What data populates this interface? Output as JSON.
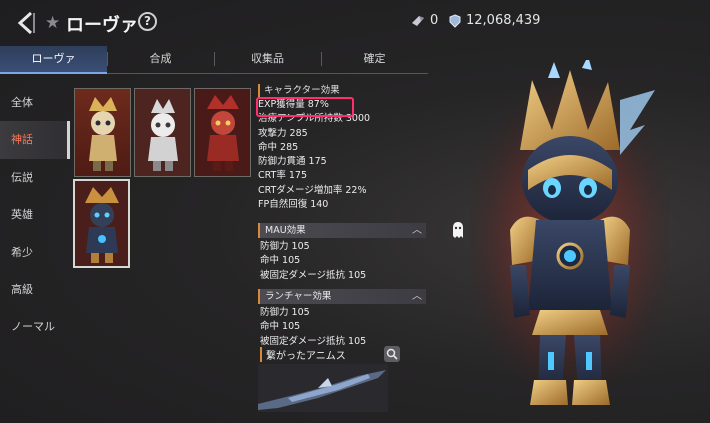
{
  "header": {
    "title": "ローヴァ",
    "help_label": "?",
    "currency_1": "0",
    "currency_2": "12,068,439"
  },
  "tabs": [
    {
      "label": "ローヴァ",
      "active": true
    },
    {
      "label": "合成",
      "active": false
    },
    {
      "label": "収集品",
      "active": false
    },
    {
      "label": "確定",
      "active": false
    }
  ],
  "sidebar": {
    "items": [
      {
        "label": "全体",
        "active": false
      },
      {
        "label": "神話",
        "active": true
      },
      {
        "label": "伝説",
        "active": false
      },
      {
        "label": "英雄",
        "active": false
      },
      {
        "label": "希少",
        "active": false
      },
      {
        "label": "高級",
        "active": false
      },
      {
        "label": "ノーマル",
        "active": false
      }
    ]
  },
  "character_effect": {
    "header": "キャラクター効果",
    "lines": [
      "EXP獲得量 87%",
      "治療アンプル所持数 3000",
      "攻撃力 285",
      "命中 285",
      "防御力貫通 175",
      "CRT率 175",
      "CRTダメージ増加率 22%",
      "FP自然回復 140"
    ]
  },
  "mau_effect": {
    "header": "MAU効果",
    "lines": [
      "防御力 105",
      "命中 105",
      "被固定ダメージ抵抗 105"
    ]
  },
  "launcher_effect": {
    "header": "ランチャー効果",
    "lines": [
      "防御力 105",
      "命中 105",
      "被固定ダメージ抵抗 105"
    ]
  },
  "animus": {
    "header": "繋がったアニムス"
  },
  "colors": {
    "accent_active": "#ff7a5a",
    "highlight_box": "#ff2f6e",
    "tab_active": "#3b4f77"
  }
}
